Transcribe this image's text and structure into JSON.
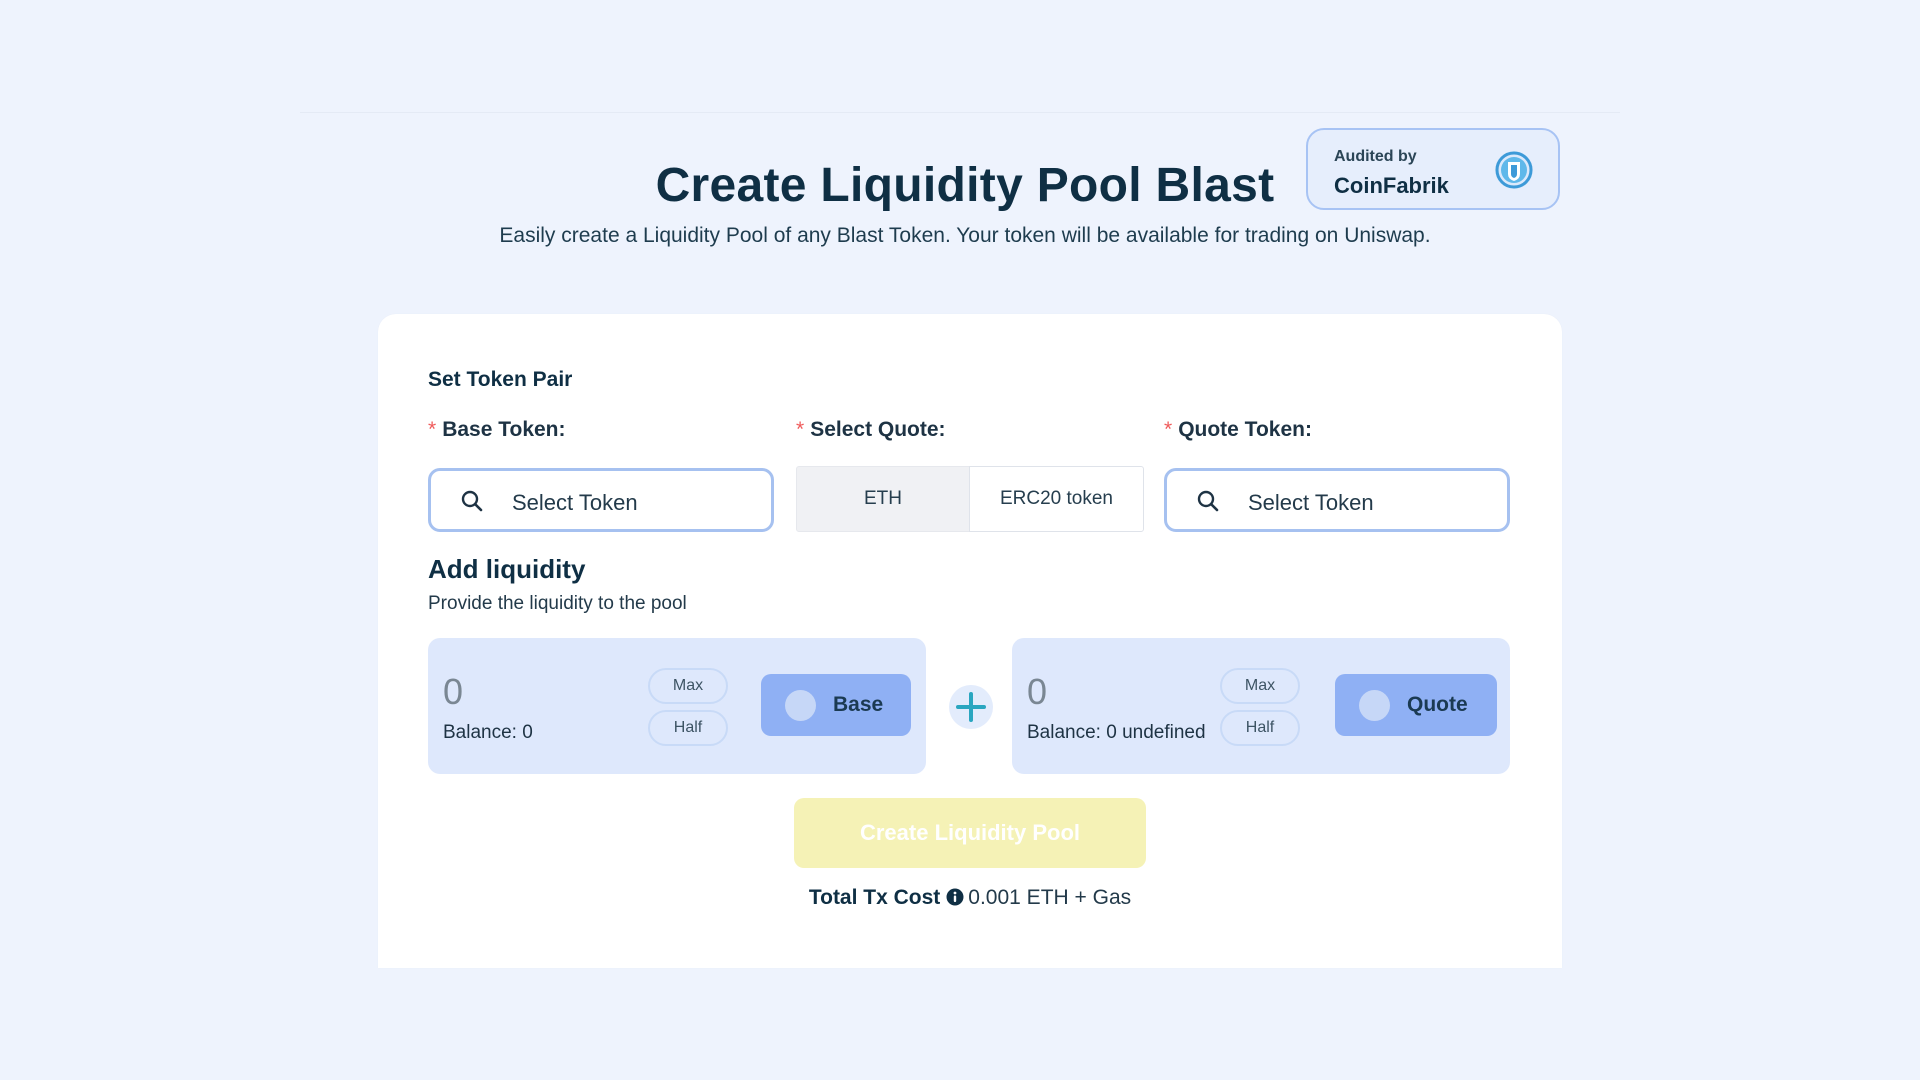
{
  "header": {
    "title": "Create Liquidity Pool Blast",
    "subtitle": "Easily create a Liquidity Pool of any Blast Token. Your token will be available for trading on Uniswap."
  },
  "audit": {
    "label": "Audited by",
    "name": "CoinFabrik",
    "icon": "coinfabrik-shield-logo"
  },
  "token_pair": {
    "heading": "Set Token Pair",
    "base": {
      "required_mark": "*",
      "label": "Base Token:",
      "placeholder": "Select Token",
      "icon": "search-icon"
    },
    "quote_select": {
      "required_mark": "*",
      "label": "Select Quote:",
      "options": [
        "ETH",
        "ERC20 token"
      ],
      "selected": "ETH"
    },
    "quote": {
      "required_mark": "*",
      "label": "Quote Token:",
      "placeholder": "Select Token",
      "icon": "search-icon"
    }
  },
  "liquidity": {
    "heading": "Add liquidity",
    "subheading": "Provide the liquidity to the pool",
    "base": {
      "amount": "0",
      "balance": "Balance: 0",
      "max_label": "Max",
      "half_label": "Half",
      "token_label": "Base"
    },
    "quote": {
      "amount": "0",
      "balance": "Balance: 0 undefined",
      "max_label": "Max",
      "half_label": "Half",
      "token_label": "Quote"
    },
    "plus_icon": "plus-icon"
  },
  "submit": {
    "label": "Create Liquidity Pool",
    "state": "disabled"
  },
  "tx_cost": {
    "label": "Total Tx Cost",
    "value": "0.001 ETH + Gas",
    "icon": "info-icon"
  },
  "colors": {
    "background": "#eef3fd",
    "card": "#ffffff",
    "accent_blue": "#8fb0f4",
    "liquidity_box": "#dee8fc",
    "create_button_disabled": "#f5f2b6",
    "required_mark": "#ef5b5b",
    "plus_icon": "#2aa6c0"
  }
}
